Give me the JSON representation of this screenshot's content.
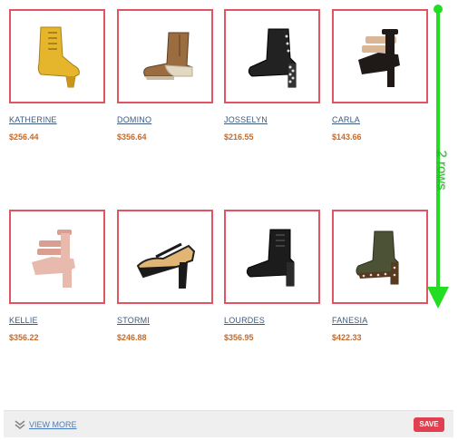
{
  "products": [
    {
      "name": "KATHERINE",
      "price": "$256.44",
      "image": "yellow-lace-up-platform-bootie"
    },
    {
      "name": "DOMINO",
      "price": "$356.64",
      "image": "tan-wedge-ankle-boot"
    },
    {
      "name": "JOSSELYN",
      "price": "$216.55",
      "image": "black-studded-lace-up-bootie"
    },
    {
      "name": "CARLA",
      "price": "$143.66",
      "image": "black-tan-strappy-platform-sandal"
    },
    {
      "name": "KELLIE",
      "price": "$356.22",
      "image": "pink-strappy-platform-sandal"
    },
    {
      "name": "STORMI",
      "price": "$246.88",
      "image": "black-tan-mary-jane-platform-pump"
    },
    {
      "name": "LOURDES",
      "price": "$356.95",
      "image": "black-lace-up-platform-bootie"
    },
    {
      "name": "FANESIA",
      "price": "$422.33",
      "image": "olive-studded-ankle-bootie"
    }
  ],
  "annotation": {
    "label": "2 rows",
    "color": "#22dd22"
  },
  "footer": {
    "view_more_label": "VIEW MORE",
    "view_more_icon": "double-chevron-down-icon",
    "save_label": "SAVE"
  },
  "colors": {
    "thumb_border": "#e05561",
    "product_name": "#3c5a80",
    "price": "#c56a2a",
    "save_button": "#e0404f"
  }
}
